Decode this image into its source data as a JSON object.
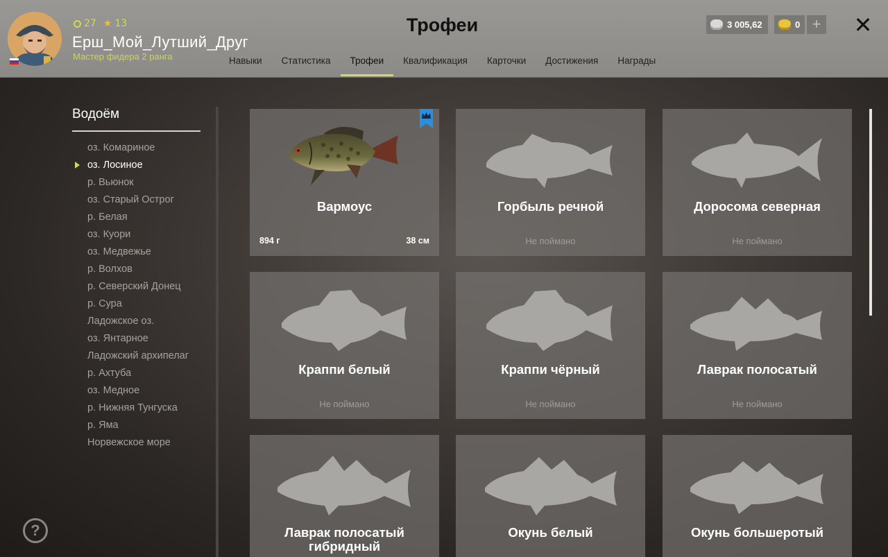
{
  "player": {
    "level": "27",
    "stars": "13",
    "name": "Ерш_Мой_Лутший_Друг",
    "rank": "Мастер фидера 2 ранга"
  },
  "header": {
    "title": "Трофеи",
    "tabs": [
      {
        "label": "Навыки",
        "active": false
      },
      {
        "label": "Статистика",
        "active": false
      },
      {
        "label": "Трофеи",
        "active": true
      },
      {
        "label": "Квалификация",
        "active": false
      },
      {
        "label": "Карточки",
        "active": false
      },
      {
        "label": "Достижения",
        "active": false
      },
      {
        "label": "Награды",
        "active": false
      }
    ],
    "silver": "3 005,62",
    "gold": "0",
    "plus_label": "+",
    "close_label": "✕"
  },
  "sidebar": {
    "heading": "Водоём",
    "items": [
      "оз. Комариное",
      "оз. Лосиное",
      "р. Вьюнок",
      "оз. Старый Острог",
      "р. Белая",
      "оз. Куори",
      "оз. Медвежье",
      "р. Волхов",
      "р. Северский Донец",
      "р. Сура",
      "Ладожское оз.",
      "оз. Янтарное",
      "Ладожский архипелаг",
      "р. Ахтуба",
      "оз. Медное",
      "р. Нижняя Тунгуска",
      "р. Яма",
      "Норвежское море"
    ],
    "selected_index": 1,
    "help_label": "?"
  },
  "trophies": [
    {
      "name": "Вармоус",
      "caught": true,
      "weight": "894 г",
      "length": "38 см",
      "icon": "warmouth-fish-icon"
    },
    {
      "name": "Горбыль речной",
      "caught": false,
      "status": "Не поймано",
      "icon": "drum-fish-silhouette-icon"
    },
    {
      "name": "Доросома северная",
      "caught": false,
      "status": "Не поймано",
      "icon": "shad-fish-silhouette-icon"
    },
    {
      "name": "Краппи белый",
      "caught": false,
      "status": "Не поймано",
      "icon": "crappie-fish-silhouette-icon"
    },
    {
      "name": "Краппи чёрный",
      "caught": false,
      "status": "Не поймано",
      "icon": "crappie-fish-silhouette-icon"
    },
    {
      "name": "Лаврак полосатый",
      "caught": false,
      "status": "Не поймано",
      "icon": "bass-fish-silhouette-icon"
    },
    {
      "name": "Лаврак полосатый гибридный",
      "caught": false,
      "status": "",
      "icon": "bass-fish-silhouette-icon"
    },
    {
      "name": "Окунь белый",
      "caught": false,
      "status": "",
      "icon": "perch-fish-silhouette-icon"
    },
    {
      "name": "Окунь большеротый",
      "caught": false,
      "status": "",
      "icon": "bass-fish-silhouette-icon"
    }
  ],
  "colors": {
    "accent": "#d2d85a",
    "badge": "#2b8fe0",
    "silhouette": "#a9a7a4"
  }
}
